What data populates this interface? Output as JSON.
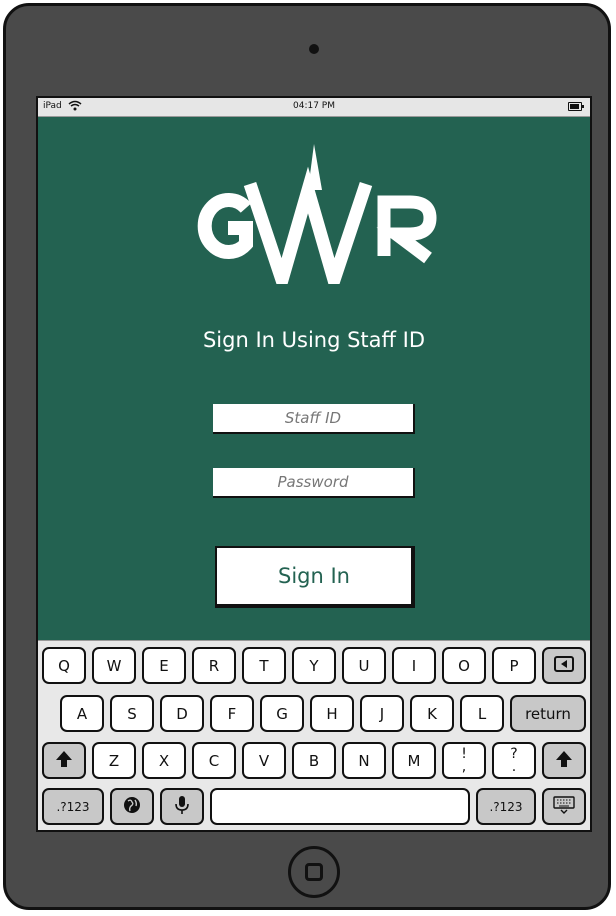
{
  "status_bar": {
    "device_name": "iPad",
    "time": "04:17 PM"
  },
  "logo": {
    "text": "GWR"
  },
  "heading": "Sign In Using Staff ID",
  "form": {
    "staff_id_placeholder": "Staff ID",
    "password_placeholder": "Password",
    "submit_label": "Sign In"
  },
  "keyboard": {
    "row1": [
      "Q",
      "W",
      "E",
      "R",
      "T",
      "Y",
      "U",
      "I",
      "O",
      "P"
    ],
    "row2": [
      "A",
      "S",
      "D",
      "F",
      "G",
      "H",
      "J",
      "K",
      "L"
    ],
    "row3": [
      "Z",
      "X",
      "C",
      "V",
      "B",
      "N",
      "M"
    ],
    "return_label": "return",
    "numbers_label": ".?123",
    "punct1_top": "!",
    "punct1_bottom": ",",
    "punct2_top": "?",
    "punct2_bottom": "."
  },
  "colors": {
    "screen_background": "#236251",
    "accent_text": "#236251",
    "device_frame": "#4a4a4a"
  }
}
